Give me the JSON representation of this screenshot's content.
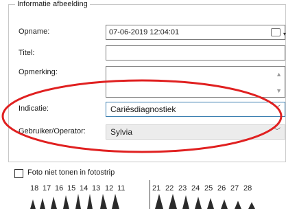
{
  "group_title": "Informatie afbeelding",
  "fields": {
    "opname": {
      "label": "Opname:",
      "value": "07-06-2019 12:04:01"
    },
    "titel": {
      "label": "Titel:",
      "value": ""
    },
    "opmerking": {
      "label": "Opmerking:",
      "value": ""
    },
    "indicatie": {
      "label": "Indicatie:",
      "value": "Cariësdiagnostiek"
    },
    "gebruiker": {
      "label": "Gebruiker/Operator:",
      "value": "Sylvia"
    }
  },
  "checkbox": {
    "label": "Foto niet tonen in fotostrip",
    "checked": false
  },
  "teeth": {
    "upper_left": [
      "18",
      "17",
      "16",
      "15",
      "14",
      "13",
      "12",
      "11"
    ],
    "upper_right": [
      "21",
      "22",
      "23",
      "24",
      "25",
      "26",
      "27",
      "28"
    ]
  },
  "colors": {
    "annotation_ellipse": "#e02020",
    "focus_border": "#3c7fb1"
  },
  "icons": {
    "calendar": "calendar-icon",
    "dropdown": "chevron-down-icon"
  }
}
